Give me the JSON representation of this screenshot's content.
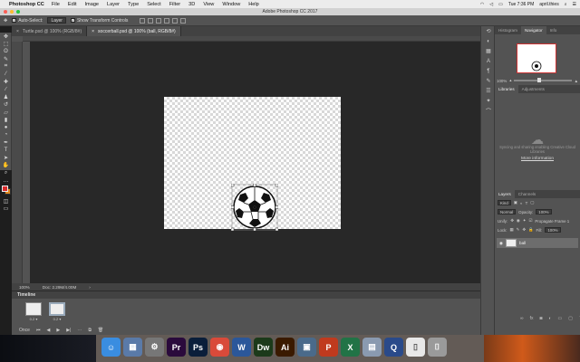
{
  "menubar": {
    "apple_icon": "apple-icon",
    "app_name": "Photoshop CC",
    "items": [
      "File",
      "Edit",
      "Image",
      "Layer",
      "Type",
      "Select",
      "Filter",
      "3D",
      "View",
      "Window",
      "Help"
    ],
    "clock": "Tue 7:36 PM",
    "user": "april.thies"
  },
  "window": {
    "title": "Adobe Photoshop CC 2017"
  },
  "options": {
    "auto_select_label": "Auto-Select:",
    "auto_select_value": "Layer",
    "transform_label": "Show Transform Controls"
  },
  "tabs": [
    {
      "label": "Turtle.psd @ 100% (RGB/8#)",
      "close": "×"
    },
    {
      "label": "soccerball.psd @ 100% (ball, RGB/8#)",
      "close": "×"
    }
  ],
  "status": {
    "zoom": "100%",
    "doc": "Doc: 2.29M/4.00M",
    "arrow": "›"
  },
  "timeline": {
    "title": "Timeline",
    "frames": [
      {
        "number": "1",
        "delay": "0.2 ▾"
      },
      {
        "number": "2",
        "delay": "0.2 ▾"
      }
    ],
    "loop": "Once"
  },
  "navigator": {
    "tabs": [
      "Histogram",
      "Navigator",
      "Info"
    ],
    "zoom": "100%"
  },
  "libraries": {
    "tabs": [
      "Libraries",
      "Adjustments"
    ],
    "message": "Syncing and sharing enabling Creative Cloud Libraries",
    "more_info": "More information"
  },
  "layers": {
    "tabs": [
      "Layers",
      "Channels"
    ],
    "kind": "Kind",
    "blend_mode": "Normal",
    "opacity_label": "Opacity:",
    "opacity_value": "100%",
    "unify_label": "Unify:",
    "propagate_label": "Propagate Frame 1",
    "lock_label": "Lock:",
    "fill_label": "Fill:",
    "fill_value": "100%",
    "layer_name": "ball"
  },
  "colors": {
    "foreground": "#d92b2b",
    "background": "#e0891f",
    "ui_dark": "#535353",
    "pasteboard": "#282828"
  },
  "dock": {
    "apps": [
      {
        "name": "finder",
        "label": "☺",
        "color": "#3a8de0"
      },
      {
        "name": "app-icon",
        "label": "▦",
        "color": "#5a7aa8"
      },
      {
        "name": "system-preferences",
        "label": "⚙",
        "color": "#777"
      },
      {
        "name": "premiere",
        "label": "Pr",
        "color": "#2a0a3c"
      },
      {
        "name": "photoshop",
        "label": "Ps",
        "color": "#0a1e3a"
      },
      {
        "name": "chrome",
        "label": "◉",
        "color": "#d94a3a"
      },
      {
        "name": "word",
        "label": "W",
        "color": "#2b579a"
      },
      {
        "name": "dreamweaver",
        "label": "Dw",
        "color": "#1c3a1a"
      },
      {
        "name": "illustrator",
        "label": "Ai",
        "color": "#3a1a00"
      },
      {
        "name": "image-capture",
        "label": "▣",
        "color": "#4a6a8a"
      },
      {
        "name": "powerpoint",
        "label": "P",
        "color": "#c03a1e"
      },
      {
        "name": "excel",
        "label": "X",
        "color": "#217346"
      },
      {
        "name": "preview",
        "label": "▤",
        "color": "#8a9ab0"
      },
      {
        "name": "quicktime",
        "label": "Q",
        "color": "#2a4a8a"
      },
      {
        "name": "document",
        "label": "▯",
        "color": "#e8e8e8"
      },
      {
        "name": "trash",
        "label": "⌷",
        "color": "#9a9a9a"
      }
    ]
  }
}
